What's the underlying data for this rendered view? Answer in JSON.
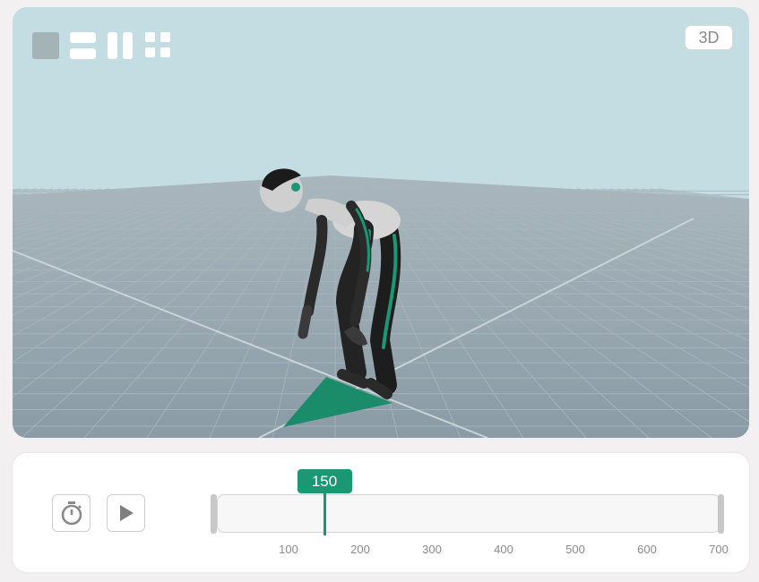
{
  "viewport": {
    "mode_badge": "3D",
    "layout_buttons": [
      "single-view-icon",
      "horizontal-split-icon",
      "vertical-split-icon",
      "quad-view-icon"
    ],
    "colors": {
      "sky": "#c4dde2",
      "floor": "#8e9fa9",
      "grid": "#a9b7bf",
      "accent": "#1a9873"
    }
  },
  "timeline": {
    "current_frame": "150",
    "min": 0,
    "max": 700,
    "current": 150,
    "ticks": [
      "100",
      "200",
      "300",
      "400",
      "500",
      "600",
      "700"
    ],
    "buttons": [
      "stopwatch-icon",
      "play-icon"
    ]
  }
}
